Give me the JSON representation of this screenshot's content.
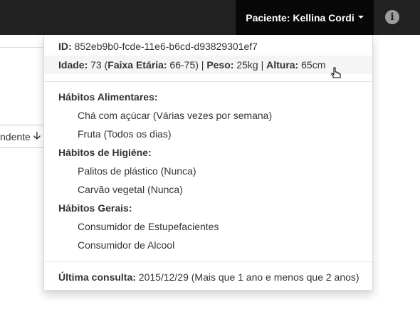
{
  "navbar": {
    "patient_prefix": "Paciente: ",
    "patient_name": "Kellina Cordi",
    "info_icon": "i"
  },
  "background": {
    "sort_label": "ndente",
    "sort_close": ")"
  },
  "dropdown": {
    "id_label": "ID:",
    "id_value": "852eb9b0-fcde-11e6-b6cd-d93829301ef7",
    "age_label": "Idade:",
    "age_value": "73",
    "age_group_label": "Faixa Etária:",
    "age_group_value": "66-75",
    "weight_label": "Peso:",
    "weight_value": "25kg",
    "height_label": "Altura:",
    "height_value": "65cm",
    "sections": [
      {
        "title": "Hábitos Alimentares:",
        "items": [
          "Chá com açúcar (Várias vezes por semana)",
          "Fruta (Todos os dias)"
        ]
      },
      {
        "title": "Hábitos de Higiéne:",
        "items": [
          "Palitos de plástico (Nunca)",
          "Carvão vegetal (Nunca)"
        ]
      },
      {
        "title": "Hábitos Gerais:",
        "items": [
          "Consumidor de Estupefacientes",
          "Consumidor de Alcool"
        ]
      }
    ],
    "last_visit_label": "Última consulta:",
    "last_visit_value": "2015/12/29 (Mais que 1 ano e menos que 2 anos)"
  }
}
